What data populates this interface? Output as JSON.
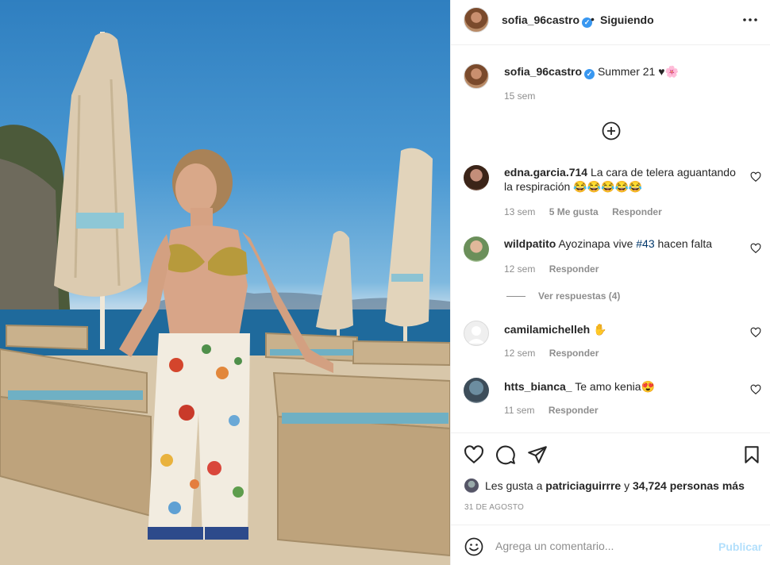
{
  "post": {
    "username": "sofia_96castro",
    "follow_separator": "•",
    "follow_status": "Siguiendo",
    "more_label": "•••",
    "caption": "Summer 21 ♥🌸",
    "caption_time": "15 sem",
    "photo_alt": "Mujer posando junto a sombrillas de playa"
  },
  "comments": [
    {
      "user": "edna.garcia.714",
      "text": "La cara de telera aguantando la respiración 😂😂😂😂😂",
      "time": "13 sem",
      "likes": "5 Me gusta",
      "reply": "Responder"
    },
    {
      "user": "wildpatito",
      "text_before": "Ayozinapa vive",
      "tag": "#43",
      "text_after": "hacen falta",
      "time": "12 sem",
      "reply": "Responder"
    },
    {
      "user": "camilamichelleh",
      "text": "✋",
      "time": "12 sem",
      "reply": "Responder"
    },
    {
      "user": "htts_bianca_",
      "text": "Te amo kenia😍",
      "time": "11 sem",
      "reply": "Responder"
    }
  ],
  "view_replies": "Ver respuestas (4)",
  "likes": {
    "prefix": "Les gusta a",
    "user": "patriciaguirrre",
    "middle": "y",
    "count": "34,724 personas más"
  },
  "date": "31 DE AGOSTO",
  "add_comment": {
    "placeholder": "Agrega un comentario...",
    "publish_label": "Publicar"
  },
  "colors": {
    "verified": "#3897f0",
    "link": "#00376b",
    "publish_disabled": "#b2dffc",
    "muted": "#8e8e8e"
  }
}
